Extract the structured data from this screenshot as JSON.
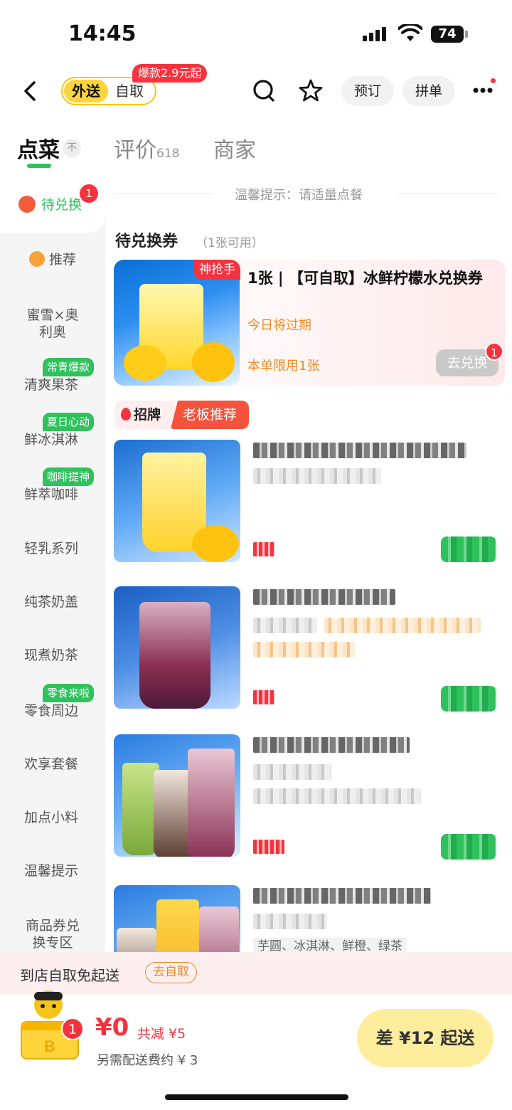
{
  "status_bar": {
    "time": "14:45",
    "battery": "74"
  },
  "header": {
    "mode_active": "外送",
    "mode_other": "自取",
    "promo_bubble": "爆款2.9元起",
    "reserve_label": "预订",
    "group_label": "拼单"
  },
  "tabs": {
    "order": "点菜",
    "collapse_icon": "不",
    "reviews": "评价",
    "reviews_count": "618",
    "merchant": "商家"
  },
  "sidebar": {
    "active": {
      "label": "待兑换",
      "badge": "1"
    },
    "items": [
      {
        "label": "推荐"
      },
      {
        "label": "蜜雪×奥利奥"
      },
      {
        "label": "清爽果茶",
        "tag": "常青爆款"
      },
      {
        "label": "鲜冰淇淋",
        "tag": "夏日心动"
      },
      {
        "label": "鲜萃咖啡",
        "tag": "咖啡提神"
      },
      {
        "label": "轻乳系列"
      },
      {
        "label": "纯茶奶盖"
      },
      {
        "label": "现煮奶茶"
      },
      {
        "label": "零食周边",
        "tag": "零食来啦"
      },
      {
        "label": "欢享套餐"
      },
      {
        "label": "加点小料"
      },
      {
        "label": "温馨提示"
      },
      {
        "label": "商品券兑换专区"
      }
    ]
  },
  "main": {
    "tip": "温馨提示：请适量点餐",
    "section_title": "待兑换券",
    "section_sub": "（1张可用）",
    "coupon": {
      "tag": "神抢手",
      "title": "1张 | 【可自取】冰鲜柠檬水兑换券",
      "expiry": "今日将过期",
      "limit": "本单限用1张",
      "redeem_label": "去兑换",
      "redeem_badge": "1"
    },
    "brand_tag": {
      "left": "招牌",
      "right": "老板推荐"
    },
    "product4_ingredients": "芋圆、冰淇淋、鲜橙、绿茶"
  },
  "bottom": {
    "pickup_text": "到店自取免起送",
    "pickup_btn": "去自取",
    "cart_badge": "1",
    "price": "¥0",
    "discount": "共减 ¥5",
    "delivery_fee": "另需配送费约 ¥ 3",
    "checkout": "差 ¥12 起送"
  },
  "colors": {
    "accent_green": "#2ec15c",
    "accent_red": "#f5333f",
    "accent_yellow": "#ffd43b",
    "accent_orange": "#f28a1c"
  }
}
